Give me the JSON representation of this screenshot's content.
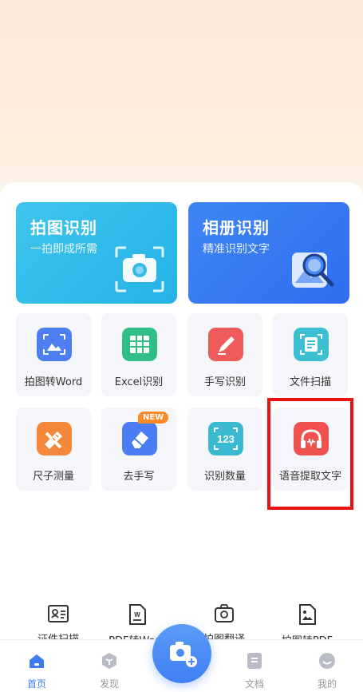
{
  "cards": {
    "photo": {
      "title": "拍图识别",
      "subtitle": "一拍即成所需"
    },
    "album": {
      "title": "相册识别",
      "subtitle": "精准识别文字"
    }
  },
  "grid": {
    "row1": [
      "拍图转Word",
      "Excel识别",
      "手写识别",
      "文件扫描"
    ],
    "row2": [
      "尺子测量",
      "去手写",
      "识别数量",
      "语音提取文字"
    ],
    "new_badge": "NEW",
    "count_icon_text": "123"
  },
  "tools": [
    "证件扫描",
    "PDF转Word",
    "拍图翻译",
    "拍图转PDF"
  ],
  "nav": {
    "home": "首页",
    "discover": "发现",
    "docs": "文档",
    "mine": "我的"
  },
  "colors": {
    "accent": "#3d7cf4",
    "highlight": "#ee1111",
    "badge": "#ff8a25"
  }
}
